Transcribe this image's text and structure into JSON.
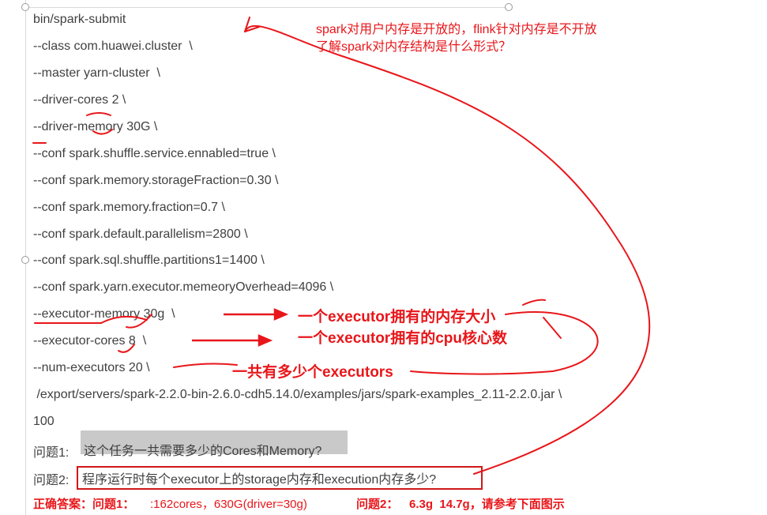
{
  "code_lines": [
    "bin/spark-submit",
    "--class com.huawei.cluster  \\",
    "--master yarn-cluster  \\",
    "--driver-cores 2 \\",
    "--driver-memory 30G \\",
    "--conf spark.shuffle.service.ennabled=true \\",
    "--conf spark.memory.storageFraction=0.30 \\",
    "--conf spark.memory.fraction=0.7 \\",
    "--conf spark.default.parallelism=2800 \\",
    "--conf spark.sql.shuffle.partitions1=1400 \\",
    "--conf spark.yarn.executor.memeoryOverhead=4096 \\",
    "--executor-memory 30g  \\",
    "--executor-cores 8  \\",
    "--num-executors 20 \\",
    " /export/servers/spark-2.2.0-bin-2.6.0-cdh5.14.0/examples/jars/spark-examples_2.11-2.2.0.jar \\",
    "100"
  ],
  "top_note": {
    "line1": "spark对用户内存是开放的，flink针对内存是不开放",
    "line2": "了解spark对内存结构是什么形式？"
  },
  "annotations": {
    "executor_memory": "一个executor拥有的内存大小",
    "executor_cores": "一个executor拥有的cpu核心数",
    "num_executors": "一共有多少个executors"
  },
  "questions": {
    "q1_label": "问题1:",
    "q1_text": "这个任务一共需要多少的Cores和Memory?",
    "q2_label": "问题2:",
    "q2_text": "程序运行时每个executor上的storage内存和execution内存多少?"
  },
  "answer": {
    "label": "正确答案：问题1：",
    "q1_value": ":162cores，630G(driver=30g)",
    "q2_label": "问题2：",
    "q2_value": "6.3g  14.7g，请参考下面图示"
  },
  "colors": {
    "annotation_red": "#e8161a",
    "code_text": "#404040",
    "highlight_gray": "#c9c9c9"
  }
}
